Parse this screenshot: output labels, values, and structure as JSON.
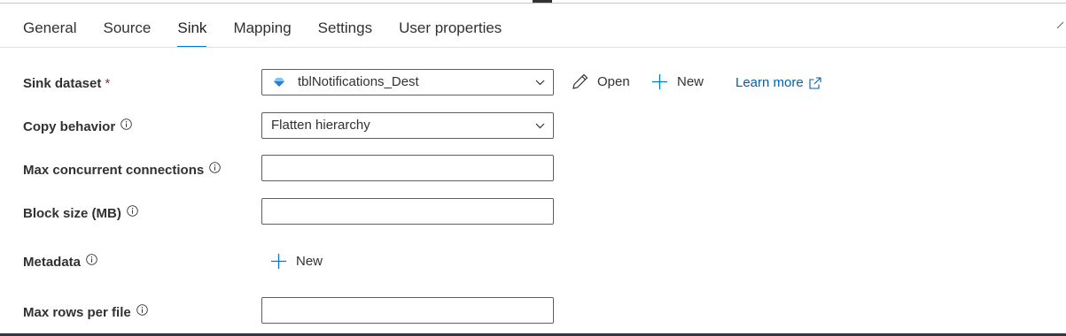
{
  "tabs": [
    {
      "label": "General"
    },
    {
      "label": "Source"
    },
    {
      "label": "Sink"
    },
    {
      "label": "Mapping"
    },
    {
      "label": "Settings"
    },
    {
      "label": "User properties"
    }
  ],
  "active_tab": "Sink",
  "sink_dataset": {
    "label": "Sink dataset",
    "required_marker": "*",
    "value": "tblNotifications_Dest",
    "icon": "dataset-icon",
    "open_label": "Open",
    "new_label": "New",
    "learn_more_label": "Learn more"
  },
  "copy_behavior": {
    "label": "Copy behavior",
    "value": "Flatten hierarchy"
  },
  "max_concurrent_connections": {
    "label": "Max concurrent connections",
    "value": ""
  },
  "block_size": {
    "label": "Block size (MB)",
    "value": ""
  },
  "metadata": {
    "label": "Metadata",
    "new_label": "New"
  },
  "max_rows_per_file": {
    "label": "Max rows per file",
    "value": ""
  },
  "colors": {
    "accent": "#0078d4",
    "link": "#0062ad",
    "required": "#a4262c"
  }
}
